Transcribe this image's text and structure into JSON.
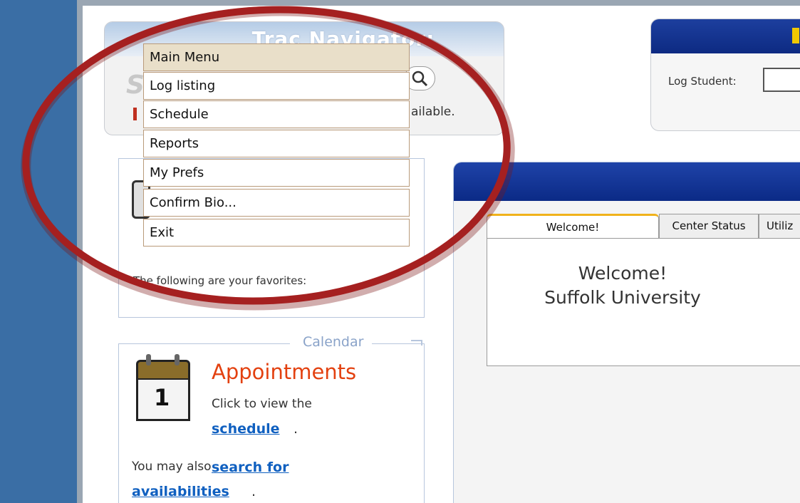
{
  "trac_nav": {
    "title": "Trac Navigator:",
    "search_letter": "S",
    "availability_fragment": "ailable."
  },
  "log_panel": {
    "label": "Log Student:"
  },
  "menu": {
    "items": [
      {
        "label": "Main Menu"
      },
      {
        "label": "Log listing"
      },
      {
        "label": "Schedule"
      },
      {
        "label": "Reports"
      },
      {
        "label": "My Prefs"
      },
      {
        "label": "Confirm Bio..."
      },
      {
        "label": "Exit"
      }
    ]
  },
  "favorites": {
    "text": "The following are your favorites:"
  },
  "calendar": {
    "legend": "Calendar",
    "day_number": "1",
    "title": "Appointments",
    "line1": "Click to view the",
    "schedule_link": "schedule",
    "period1": ".",
    "line2": "You may also",
    "search_link": "search for",
    "availabilities_link": "availabilities",
    "period2": "."
  },
  "main": {
    "tabs": [
      {
        "label": "Welcome!"
      },
      {
        "label": "Center Status"
      },
      {
        "label": "Utiliz"
      }
    ],
    "welcome_line1": "Welcome!",
    "welcome_line2": "Suffolk University"
  },
  "colors": {
    "side_strip": "#3a6ea5",
    "header_blue": "#0b2a86",
    "annotation_red": "#9c1d1d",
    "appointments_orange": "#e34110",
    "link_blue": "#1060c0",
    "menu_header": "#e9dfc9"
  }
}
